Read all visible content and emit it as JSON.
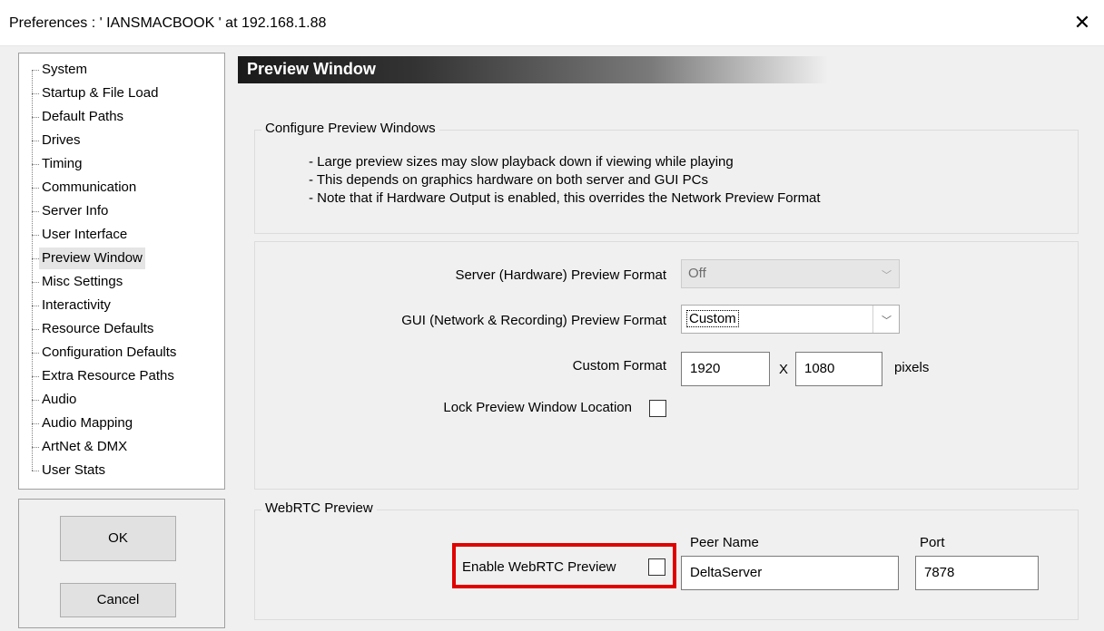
{
  "window": {
    "title": "Preferences  :  ' IANSMACBOOK '  at  192.168.1.88"
  },
  "tree": {
    "items": [
      {
        "label": "System"
      },
      {
        "label": "Startup & File Load"
      },
      {
        "label": "Default Paths"
      },
      {
        "label": "Drives"
      },
      {
        "label": "Timing"
      },
      {
        "label": "Communication"
      },
      {
        "label": "Server Info"
      },
      {
        "label": "User Interface"
      },
      {
        "label": "Preview Window"
      },
      {
        "label": "Misc Settings"
      },
      {
        "label": "Interactivity"
      },
      {
        "label": "Resource Defaults"
      },
      {
        "label": "Configuration Defaults"
      },
      {
        "label": "Extra Resource Paths"
      },
      {
        "label": "Audio"
      },
      {
        "label": "Audio Mapping"
      },
      {
        "label": "ArtNet & DMX"
      },
      {
        "label": "User Stats"
      }
    ],
    "selected": "Preview Window"
  },
  "buttons": {
    "ok": "OK",
    "cancel": "Cancel"
  },
  "section": {
    "title": "Preview Window"
  },
  "configure": {
    "title": "Configure Preview Windows",
    "notes": [
      "- Large preview sizes may slow playback down if viewing while playing",
      "- This depends on graphics hardware on both server and GUI PCs",
      "- Note that if Hardware Output is enabled, this overrides the Network Preview Format"
    ]
  },
  "format": {
    "server_label": "Server (Hardware) Preview Format",
    "server_value": "Off",
    "gui_label": "GUI (Network & Recording) Preview Format",
    "gui_value": "Custom",
    "custom_label": "Custom Format",
    "width": "1920",
    "x_sep": "X",
    "height": "1080",
    "unit": "pixels",
    "lock_label": "Lock Preview Window Location"
  },
  "webrtc": {
    "title": "WebRTC Preview",
    "enable_label": "Enable WebRTC Preview",
    "peer_label": "Peer Name",
    "peer_value": "DeltaServer",
    "port_label": "Port",
    "port_value": "7878"
  },
  "icons": {
    "close": "close-icon",
    "dropdown": "chevron-down-icon"
  },
  "colors": {
    "highlight": "#e00000",
    "header_dark": "#1a1a1a"
  }
}
